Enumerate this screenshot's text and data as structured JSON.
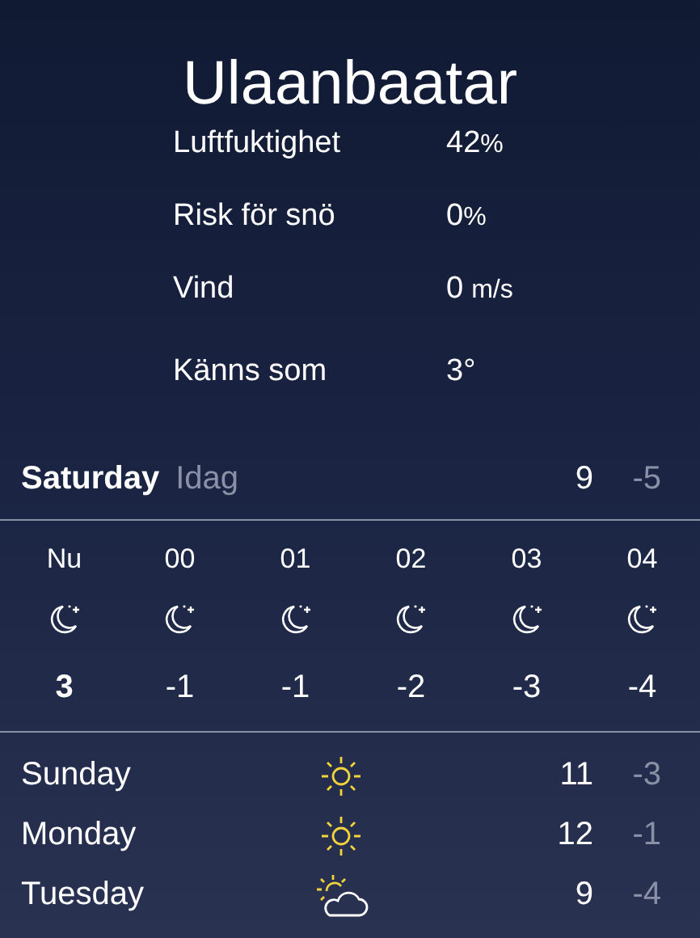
{
  "city": "Ulaanbaatar",
  "details": [
    {
      "label": "Luftfuktighet",
      "value": "42",
      "unit": "%"
    },
    {
      "label": "Risk för snö",
      "value": "0",
      "unit": "%"
    },
    {
      "label": "Vind",
      "value": "0",
      "unit": "m/s"
    },
    {
      "label": "Känns som",
      "value": "3°"
    }
  ],
  "today": {
    "day": "Saturday",
    "tag": "Idag",
    "high": "9",
    "low": "-5"
  },
  "hourly": [
    {
      "time": "Nu",
      "kind": "moon",
      "temp": "3",
      "now": true
    },
    {
      "time": "00",
      "kind": "moon",
      "temp": "-1",
      "now": false
    },
    {
      "time": "01",
      "kind": "moon",
      "temp": "-1",
      "now": false
    },
    {
      "time": "02",
      "kind": "moon",
      "temp": "-2",
      "now": false
    },
    {
      "time": "03",
      "kind": "moon",
      "temp": "-3",
      "now": false
    },
    {
      "time": "04",
      "kind": "moon",
      "temp": "-4",
      "now": false
    }
  ],
  "daily": [
    {
      "day": "Sunday",
      "kind": "sun",
      "high": "11",
      "low": "-3"
    },
    {
      "day": "Monday",
      "kind": "sun",
      "high": "12",
      "low": "-1"
    },
    {
      "day": "Tuesday",
      "kind": "partly-cloudy",
      "high": "9",
      "low": "-4"
    }
  ]
}
